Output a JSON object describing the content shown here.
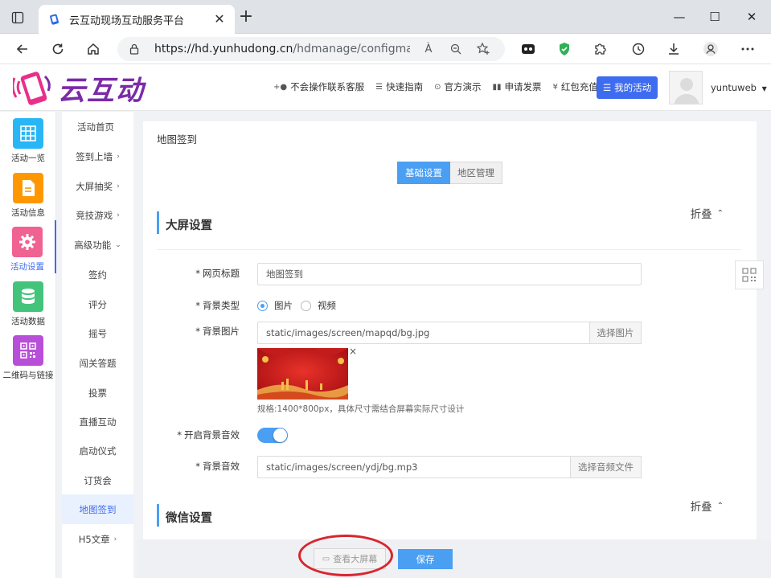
{
  "browser": {
    "tab_title": "云互动现场互动服务平台",
    "url_host": "https://hd.yunhudong.cn",
    "url_path": "/hdmanage/configmapq...",
    "read_aloud": "À"
  },
  "header": {
    "logo_text": "云互动",
    "nav": [
      {
        "icon": "person-add",
        "label": "不会操作联系客服"
      },
      {
        "icon": "list",
        "label": "快速指南"
      },
      {
        "icon": "play-circle",
        "label": "官方演示"
      },
      {
        "icon": "invoice",
        "label": "申请发票"
      },
      {
        "icon": "yen",
        "label": "红包充值"
      }
    ],
    "my_activity": "我的活动",
    "username": "yuntuweb"
  },
  "iconbar": [
    {
      "label": "活动一览",
      "color": "#29b6f6",
      "icon": "grid-icon"
    },
    {
      "label": "活动信息",
      "color": "#ff9800",
      "icon": "document-icon"
    },
    {
      "label": "活动设置",
      "color": "#f06292",
      "icon": "gear-icon",
      "active": true
    },
    {
      "label": "活动数据",
      "color": "#43c47a",
      "icon": "database-icon"
    },
    {
      "label": "二维码与链接",
      "color": "#b84fd8",
      "icon": "qrcode-icon"
    }
  ],
  "submenu": [
    {
      "label": "活动首页",
      "arrow": ""
    },
    {
      "label": "签到上墙",
      "arrow": "›"
    },
    {
      "label": "大屏抽奖",
      "arrow": "›"
    },
    {
      "label": "竞技游戏",
      "arrow": "›"
    },
    {
      "label": "高级功能",
      "arrow": "⌄"
    },
    {
      "label": "签约",
      "arrow": ""
    },
    {
      "label": "评分",
      "arrow": ""
    },
    {
      "label": "摇号",
      "arrow": ""
    },
    {
      "label": "闯关答题",
      "arrow": ""
    },
    {
      "label": "投票",
      "arrow": ""
    },
    {
      "label": "直播互动",
      "arrow": ""
    },
    {
      "label": "启动仪式",
      "arrow": ""
    },
    {
      "label": "订货会",
      "arrow": ""
    },
    {
      "label": "地图签到",
      "arrow": "",
      "active": true
    },
    {
      "label": "H5文章",
      "arrow": "›"
    }
  ],
  "main": {
    "breadcrumb": "地图签到",
    "tabs": [
      {
        "label": "基础设置",
        "active": true
      },
      {
        "label": "地区管理",
        "active": false
      }
    ],
    "section1": {
      "title": "大屏设置",
      "fold": "折叠"
    },
    "section2": {
      "title": "微信设置",
      "fold": "折叠"
    },
    "form": {
      "page_title_label": "网页标题",
      "page_title_value": "地图签到",
      "bg_type_label": "背景类型",
      "bg_type_options": [
        "图片",
        "视频"
      ],
      "bg_image_label": "背景图片",
      "bg_image_value": "static/images/screen/mapqd/bg.jpg",
      "bg_image_button": "选择图片",
      "bg_image_hint": "规格:1400*800px，具体尺寸需结合屏幕实际尺寸设计",
      "bg_sound_toggle_label": "开启背景音效",
      "bg_sound_label": "背景音效",
      "bg_sound_value": "static/images/screen/ydj/bg.mp3",
      "bg_sound_button": "选择音频文件",
      "required_mark": "*",
      "remove_mark": "×"
    }
  },
  "footer": {
    "view_screen": "查看大屏幕",
    "save": "保存"
  },
  "colors": {
    "accent": "#4b9ff2",
    "primary_button": "#3e6cf0",
    "logo": "#7b2aa8",
    "highlight": "#d9262e"
  }
}
